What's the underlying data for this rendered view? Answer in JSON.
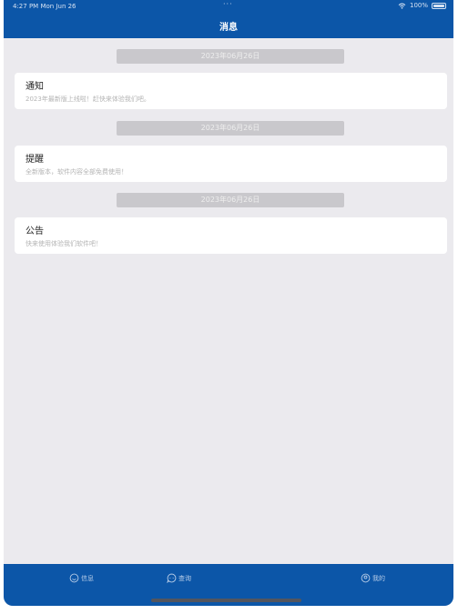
{
  "status_bar": {
    "time": "4:27 PM",
    "date": "Mon Jun 26",
    "battery": "100%",
    "battery_level": 1.0
  },
  "header": {
    "title": "消息"
  },
  "messages": [
    {
      "date": "2023年06月26日",
      "title": "通知",
      "body": "2023年最新版上线啦！赶快来体验我们吧。"
    },
    {
      "date": "2023年06月26日",
      "title": "提醒",
      "body": "全新版本，软件内容全部免费使用！"
    },
    {
      "date": "2023年06月26日",
      "title": "公告",
      "body": "快来使用体验我们软件吧！"
    }
  ],
  "tabs": [
    {
      "label": "信息",
      "icon": "smile-icon"
    },
    {
      "label": "查询",
      "icon": "chat-icon"
    },
    {
      "label": "我的",
      "icon": "profile-icon"
    }
  ],
  "colors": {
    "brand": "#0c56a8",
    "background": "#ebeaee",
    "card": "#ffffff",
    "date_pill": "#c9c8cc"
  }
}
